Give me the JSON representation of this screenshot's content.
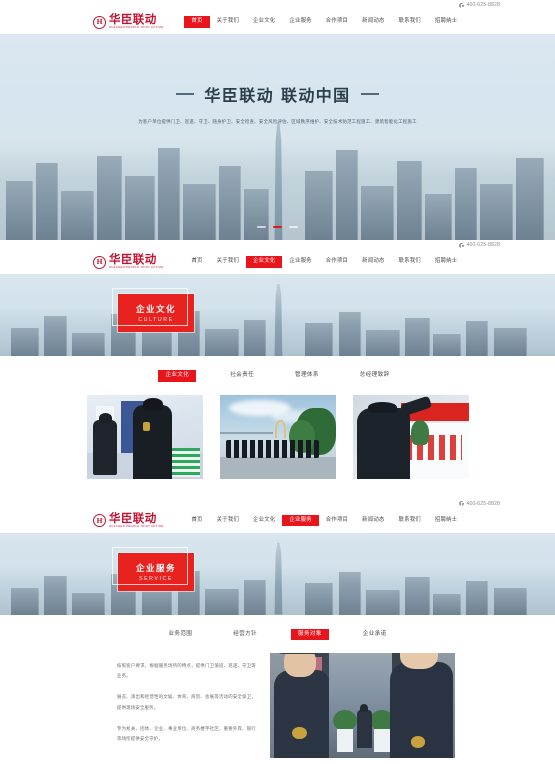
{
  "brand": {
    "logo_cn": "华臣联动",
    "logo_en": "HUACHEN PEOPLE JOINT ACTION",
    "logo_mark": "H",
    "accent_color": "#e8161c",
    "brand_red": "#c8102e"
  },
  "topbar": {
    "phone_icon": "phone-icon",
    "phone": "400-625-8828"
  },
  "nav": {
    "items": [
      {
        "label": "首页",
        "active": true
      },
      {
        "label": "关于我们",
        "active": false
      },
      {
        "label": "企业文化",
        "active": false
      },
      {
        "label": "企业服务",
        "active": false
      },
      {
        "label": "合作项目",
        "active": false
      },
      {
        "label": "新闻动态",
        "active": false
      },
      {
        "label": "联系我们",
        "active": false
      },
      {
        "label": "招聘纳士",
        "active": false
      }
    ]
  },
  "nav_culture": {
    "items": [
      {
        "label": "首页",
        "active": false
      },
      {
        "label": "关于我们",
        "active": false
      },
      {
        "label": "企业文化",
        "active": true
      },
      {
        "label": "企业服务",
        "active": false
      },
      {
        "label": "合作项目",
        "active": false
      },
      {
        "label": "新闻动态",
        "active": false
      },
      {
        "label": "联系我们",
        "active": false
      },
      {
        "label": "招聘纳士",
        "active": false
      }
    ]
  },
  "nav_service": {
    "items": [
      {
        "label": "首页",
        "active": false
      },
      {
        "label": "关于我们",
        "active": false
      },
      {
        "label": "企业文化",
        "active": false
      },
      {
        "label": "企业服务",
        "active": true
      },
      {
        "label": "合作项目",
        "active": false
      },
      {
        "label": "新闻动态",
        "active": false
      },
      {
        "label": "联系我们",
        "active": false
      },
      {
        "label": "招聘纳士",
        "active": false
      }
    ]
  },
  "hero": {
    "title": "华臣联动 联动中国",
    "subtitle": "为客户单位提供门卫、巡逻、守卫、随身护卫、安全检查、安全风险评估、区域秩序维护、安全技术防范工程施工、建筑智能化工程施工",
    "slide_dots": 3,
    "active_dot": 1
  },
  "culture_banner": {
    "title_cn": "企业文化",
    "title_en": "CULTURE"
  },
  "culture_tabs": {
    "items": [
      {
        "label": "企业文化",
        "active": true
      },
      {
        "label": "社会责任",
        "active": false
      },
      {
        "label": "管理体系",
        "active": false
      },
      {
        "label": "总经理致辞",
        "active": false
      }
    ]
  },
  "culture_gallery": {
    "photos": [
      {
        "alt": "展会现场安保人员值守照片"
      },
      {
        "alt": "海滨列队整齐的保安队伍照片"
      },
      {
        "alt": "安保人员张贴宣传横幅照片"
      }
    ]
  },
  "service_banner": {
    "title_cn": "企业服务",
    "title_en": "SERVICE"
  },
  "service_tabs": {
    "items": [
      {
        "label": "业务范围",
        "active": false
      },
      {
        "label": "经营方针",
        "active": false
      },
      {
        "label": "服务对象",
        "active": true
      },
      {
        "label": "企业承诺",
        "active": false
      }
    ]
  },
  "service_content": {
    "paragraph1": "按照客户要求，根据服务场所的特点，提供门卫值班、巡逻、守卫等业务。",
    "paragraph2": "展览、演出和经营性的文娱、体育、商贸、会展等活动的安全保卫，提供现场安全服务。",
    "paragraph3": "专为机关、团体、企业、事业单位、商务楼宇社区、重要外宾、银行等场所提供安全守护。",
    "photo_alt": "两名保安人员在大楼前执勤照片"
  }
}
